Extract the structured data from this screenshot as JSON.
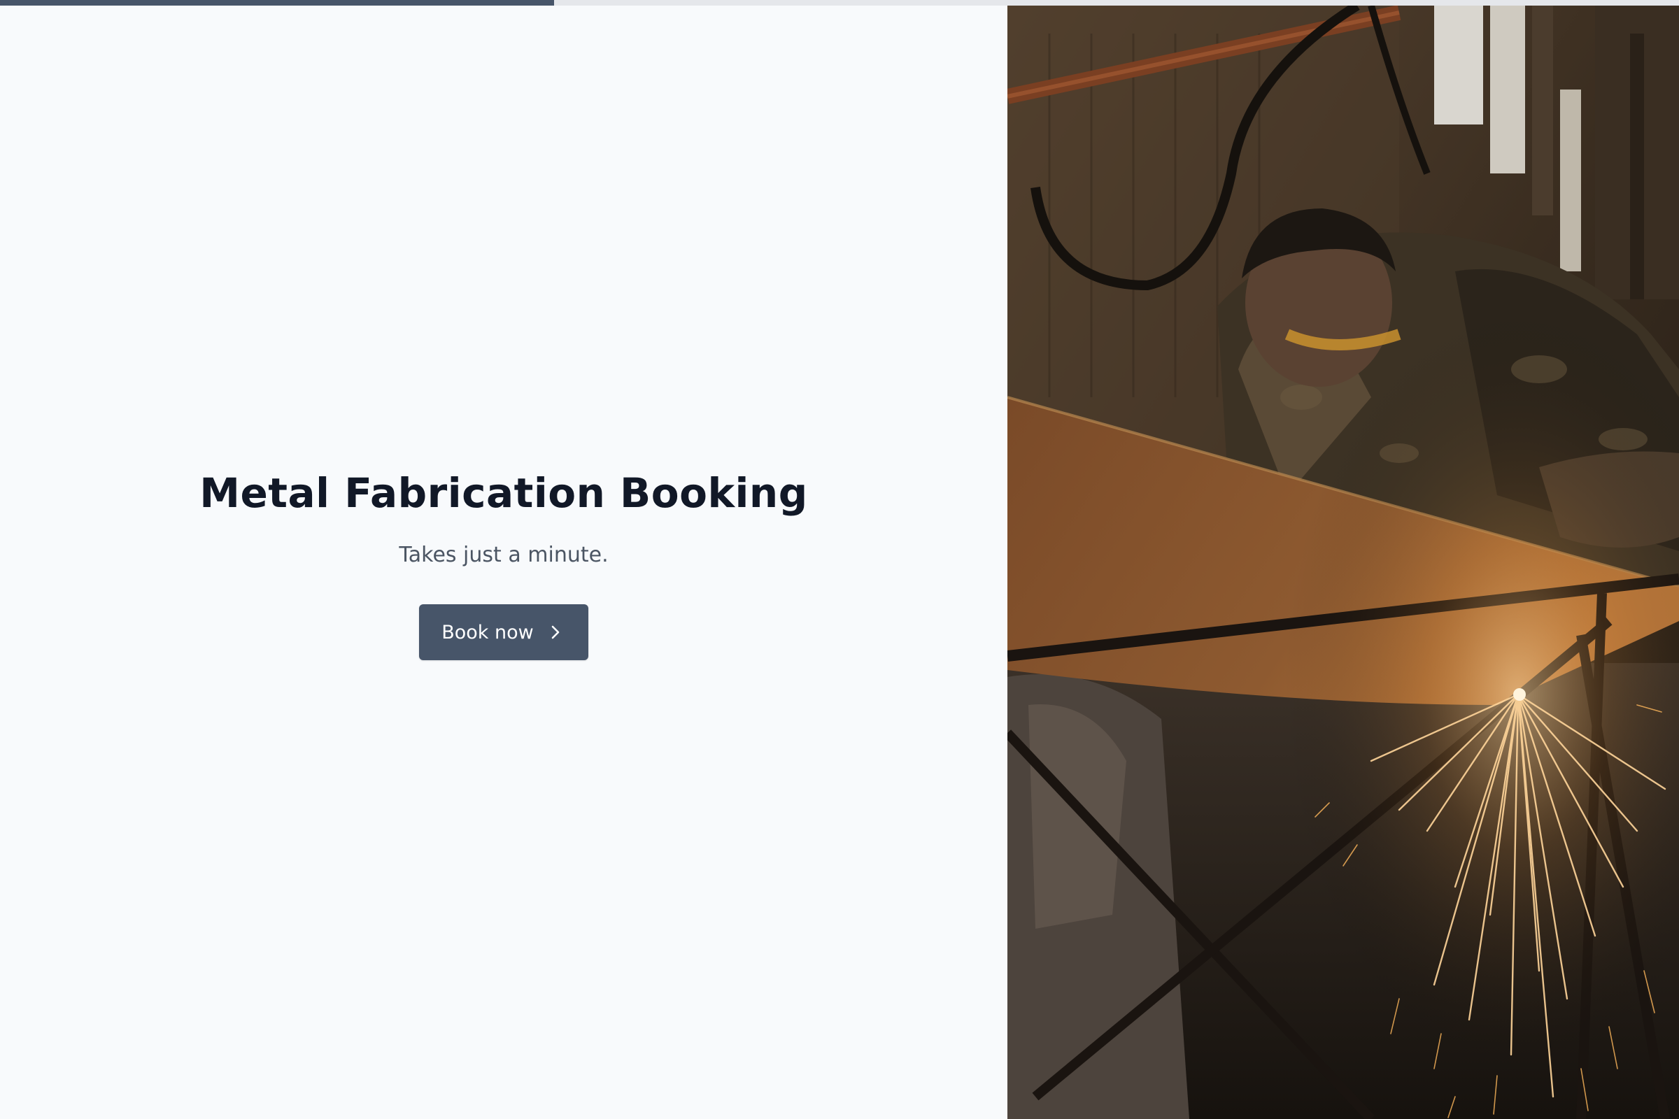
{
  "progress": {
    "value": 0.33,
    "fill_color": "#475569",
    "track_color": "#e5e7eb"
  },
  "hero": {
    "title": "Metal Fabrication Booking",
    "subtitle": "Takes just a minute.",
    "button_label": "Book now",
    "button_icon": "chevron-right-icon"
  },
  "colors": {
    "background": "#f8fafc",
    "title": "#111827",
    "subtitle": "#4b5563",
    "button": "#475569",
    "button_text": "#ffffff"
  },
  "image": {
    "subject": "welder-grinding-metal-with-sparks"
  }
}
